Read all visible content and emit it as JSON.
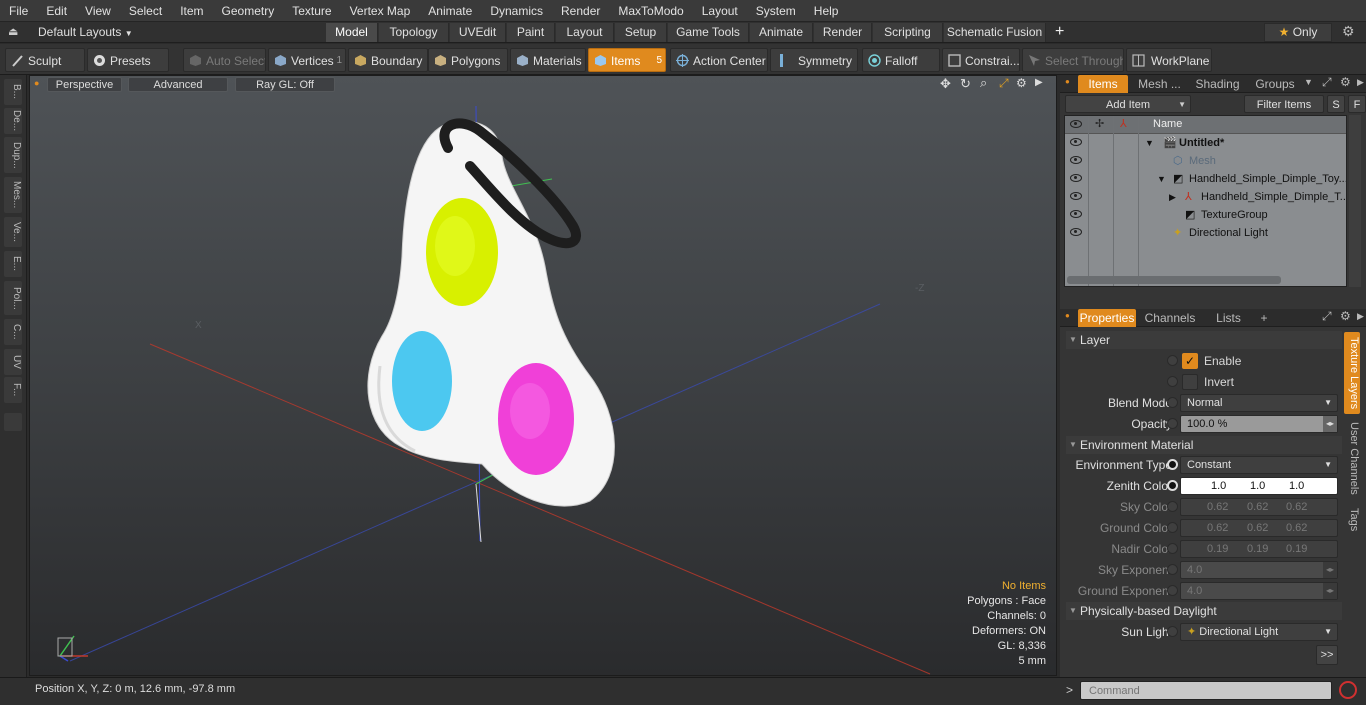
{
  "menu": [
    "File",
    "Edit",
    "View",
    "Select",
    "Item",
    "Geometry",
    "Texture",
    "Vertex Map",
    "Animate",
    "Dynamics",
    "Render",
    "MaxToModo",
    "Layout",
    "System",
    "Help"
  ],
  "layoutbar": {
    "layouts_label": "Default Layouts",
    "tabs": [
      "Model",
      "Topology",
      "UVEdit",
      "Paint",
      "Layout",
      "Setup",
      "Game Tools",
      "Animate",
      "Render",
      "Scripting",
      "Schematic Fusion"
    ],
    "add": "+",
    "only_label": "Only"
  },
  "toolbar": {
    "sculpt": "Sculpt",
    "presets": "Presets",
    "auto_select": "Auto Select",
    "vertices": "Vertices",
    "vertices_count": "1",
    "boundary": "Boundary",
    "polygons": "Polygons",
    "materials": "Materials",
    "items": "Items",
    "items_count": "5",
    "action_center": "Action Center",
    "symmetry": "Symmetry",
    "falloff": "Falloff",
    "constraints": "Constrai...",
    "select_through": "Select Through",
    "workplane": "WorkPlane"
  },
  "left_tabs": [
    "B...",
    "De...",
    "Dup...",
    "Mes...",
    "Ve...",
    "E...",
    "Pol...",
    "C...",
    "UV",
    "F..."
  ],
  "viewport": {
    "perspective": "Perspective",
    "advanced": "Advanced",
    "raygl": "Ray GL: Off",
    "stats": {
      "no_items": "No Items",
      "polygons": "Polygons : Face",
      "channels": "Channels: 0",
      "deformers": "Deformers: ON",
      "gl": "GL: 8,336",
      "unit": "5 mm"
    }
  },
  "items_panel": {
    "tabs": [
      "Items",
      "Mesh ...",
      "Shading",
      "Groups"
    ],
    "add_item": "Add Item",
    "filter_items": "Filter Items",
    "s_btn": "S",
    "f_btn": "F",
    "name_header": "Name",
    "rows": [
      {
        "label": "Untitled*"
      },
      {
        "label": "Mesh"
      },
      {
        "label": "Handheld_Simple_Dimple_Toy..."
      },
      {
        "label": "Handheld_Simple_Dimple_T..."
      },
      {
        "label": "TextureGroup"
      },
      {
        "label": "Directional Light"
      }
    ]
  },
  "properties_panel": {
    "tabs": [
      "Properties",
      "Channels",
      "Lists",
      "+"
    ],
    "side_tabs": [
      "Texture Layers",
      "User Channels",
      "Tags"
    ],
    "layer_section": "Layer",
    "enable": "Enable",
    "invert": "Invert",
    "blend_mode_label": "Blend Mode",
    "blend_mode": "Normal",
    "opacity_label": "Opacity",
    "opacity": "100.0 %",
    "env_section": "Environment Material",
    "env_type_label": "Environment Type",
    "env_type": "Constant",
    "zenith_label": "Zenith Color",
    "zenith": [
      "1.0",
      "1.0",
      "1.0"
    ],
    "sky_label": "Sky Color",
    "sky": [
      "0.62",
      "0.62",
      "0.62"
    ],
    "ground_label": "Ground Color",
    "ground": [
      "0.62",
      "0.62",
      "0.62"
    ],
    "nadir_label": "Nadir Color",
    "nadir": [
      "0.19",
      "0.19",
      "0.19"
    ],
    "sky_exp_label": "Sky Exponent",
    "sky_exp": "4.0",
    "ground_exp_label": "Ground Exponent",
    "ground_exp": "4.0",
    "daylight_section": "Physically-based Daylight",
    "sun_light_label": "Sun Light",
    "sun_light": "Directional Light",
    "more": ">>"
  },
  "statusbar": {
    "position": "Position X, Y, Z:   0 m, 12.6 mm, -97.8 mm",
    "command_placeholder": "Command",
    "prompt": ">"
  },
  "colors": {
    "accent": "#e08a1e",
    "yellow_dimple": "#d8f000",
    "cyan_dimple": "#4cc8f0",
    "magenta_dimple": "#f040d8"
  }
}
